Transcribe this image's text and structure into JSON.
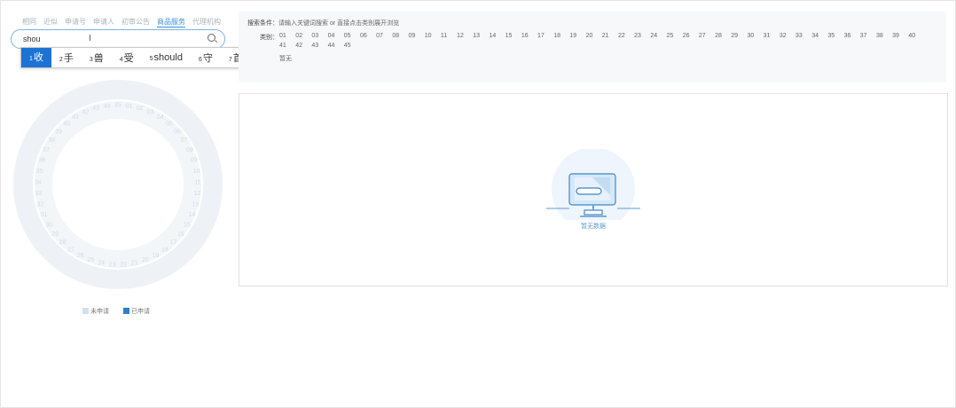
{
  "tabs": [
    "相同",
    "近似",
    "申请号",
    "申请人",
    "初审公告",
    "商品服务",
    "代理机构"
  ],
  "active_tab_index": 5,
  "search": {
    "value": "shou"
  },
  "ime": {
    "candidates": [
      {
        "num": "1",
        "text": "收"
      },
      {
        "num": "2",
        "text": "手"
      },
      {
        "num": "3",
        "text": "兽"
      },
      {
        "num": "4",
        "text": "受"
      },
      {
        "num": "5",
        "text": "should"
      },
      {
        "num": "6",
        "text": "守"
      },
      {
        "num": "7",
        "text": "首"
      }
    ],
    "emoji_symbol": "☺"
  },
  "filter": {
    "label": "搜索条件：",
    "hint": "请输入关键词搜索 or 直接点击类别展开浏览",
    "category_label": "类别：",
    "categories": [
      "01",
      "02",
      "03",
      "04",
      "05",
      "06",
      "07",
      "08",
      "09",
      "10",
      "11",
      "12",
      "13",
      "14",
      "15",
      "16",
      "17",
      "18",
      "19",
      "20",
      "21",
      "22",
      "23",
      "24",
      "25",
      "26",
      "27",
      "28",
      "29",
      "30",
      "31",
      "32",
      "33",
      "34",
      "35",
      "36",
      "37",
      "38",
      "39",
      "40",
      "41",
      "42",
      "43",
      "44",
      "45"
    ],
    "none_text": "暂无"
  },
  "wheel": {
    "outer_labels": [
      "45",
      "01",
      "02",
      "03",
      "04",
      "05",
      "06",
      "07",
      "08",
      "09",
      "10",
      "11",
      "12",
      "13",
      "14",
      "15",
      "16",
      "17",
      "18",
      "19",
      "20",
      "21",
      "22",
      "23",
      "24",
      "25",
      "26",
      "27",
      "28",
      "29",
      "30",
      "31",
      "32",
      "33",
      "34",
      "35",
      "36",
      "37",
      "38",
      "39",
      "40",
      "41",
      "42",
      "43",
      "44"
    ],
    "ring_color": "#eef2f6",
    "label_color": "#d3dae2"
  },
  "legend": [
    {
      "label": "未申请",
      "color": "#cfe1f2"
    },
    {
      "label": "已申请",
      "color": "#2f7fc5"
    }
  ],
  "empty_state": {
    "text": "暂无数据"
  },
  "colors": {
    "accent": "#1c73d3"
  }
}
